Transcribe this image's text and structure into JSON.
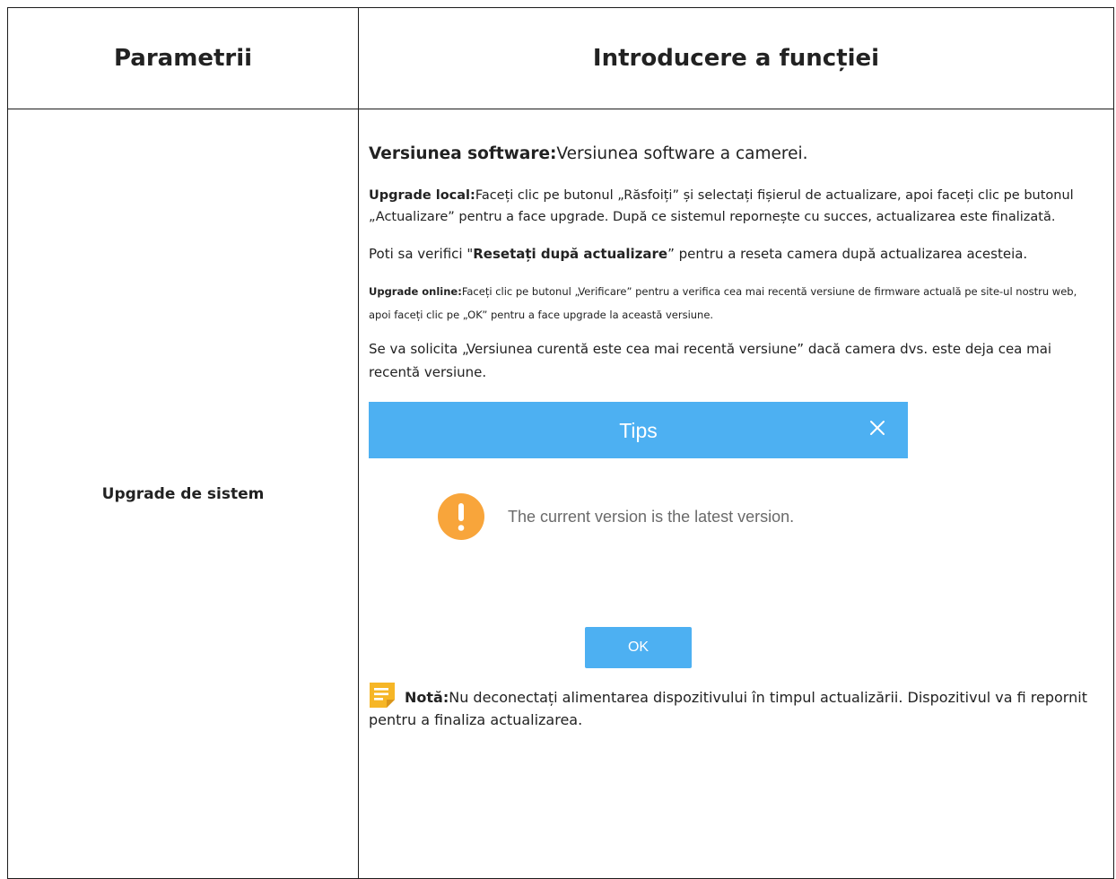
{
  "table": {
    "header_param": "Parametrii",
    "header_function": "Introducere a funcției",
    "param_name": "Upgrade de sistem"
  },
  "desc": {
    "software_label": "Versiunea software:",
    "software_text": "Versiunea software a camerei.",
    "local_label": "Upgrade local:",
    "local_text": "Faceți clic pe butonul „Răsfoiți” și selectați fișierul de actualizare, apoi faceți clic pe butonul „Actualizare” pentru a face upgrade. După ce sistemul repornește cu succes, actualizarea este finalizată.",
    "reset_prefix": "Poti sa verifici \"",
    "reset_bold": "Resetați după actualizare",
    "reset_suffix": "” pentru a reseta camera după actualizarea acesteia.",
    "online_label": "Upgrade online:",
    "online_text": "Faceți clic pe butonul „Verificare” pentru a verifica cea mai recentă versiune de firmware actuală pe site-ul nostru web, apoi faceți clic pe „OK” pentru a face upgrade la această versiune.",
    "prompt_text": "Se va solicita „Versiunea curentă este cea mai recentă versiune” dacă camera dvs. este deja cea mai recentă versiune."
  },
  "dialog": {
    "title": "Tips",
    "message": "The current version is the latest version.",
    "ok_label": "OK",
    "header_color": "#4db0f2",
    "warning_color": "#f8a53b"
  },
  "note": {
    "label": "Notă:",
    "text": "Nu deconectați alimentarea dispozitivului în timpul actualizării. Dispozitivul va fi repornit pentru a finaliza actualizarea.",
    "icon_color": "#f6b626"
  }
}
